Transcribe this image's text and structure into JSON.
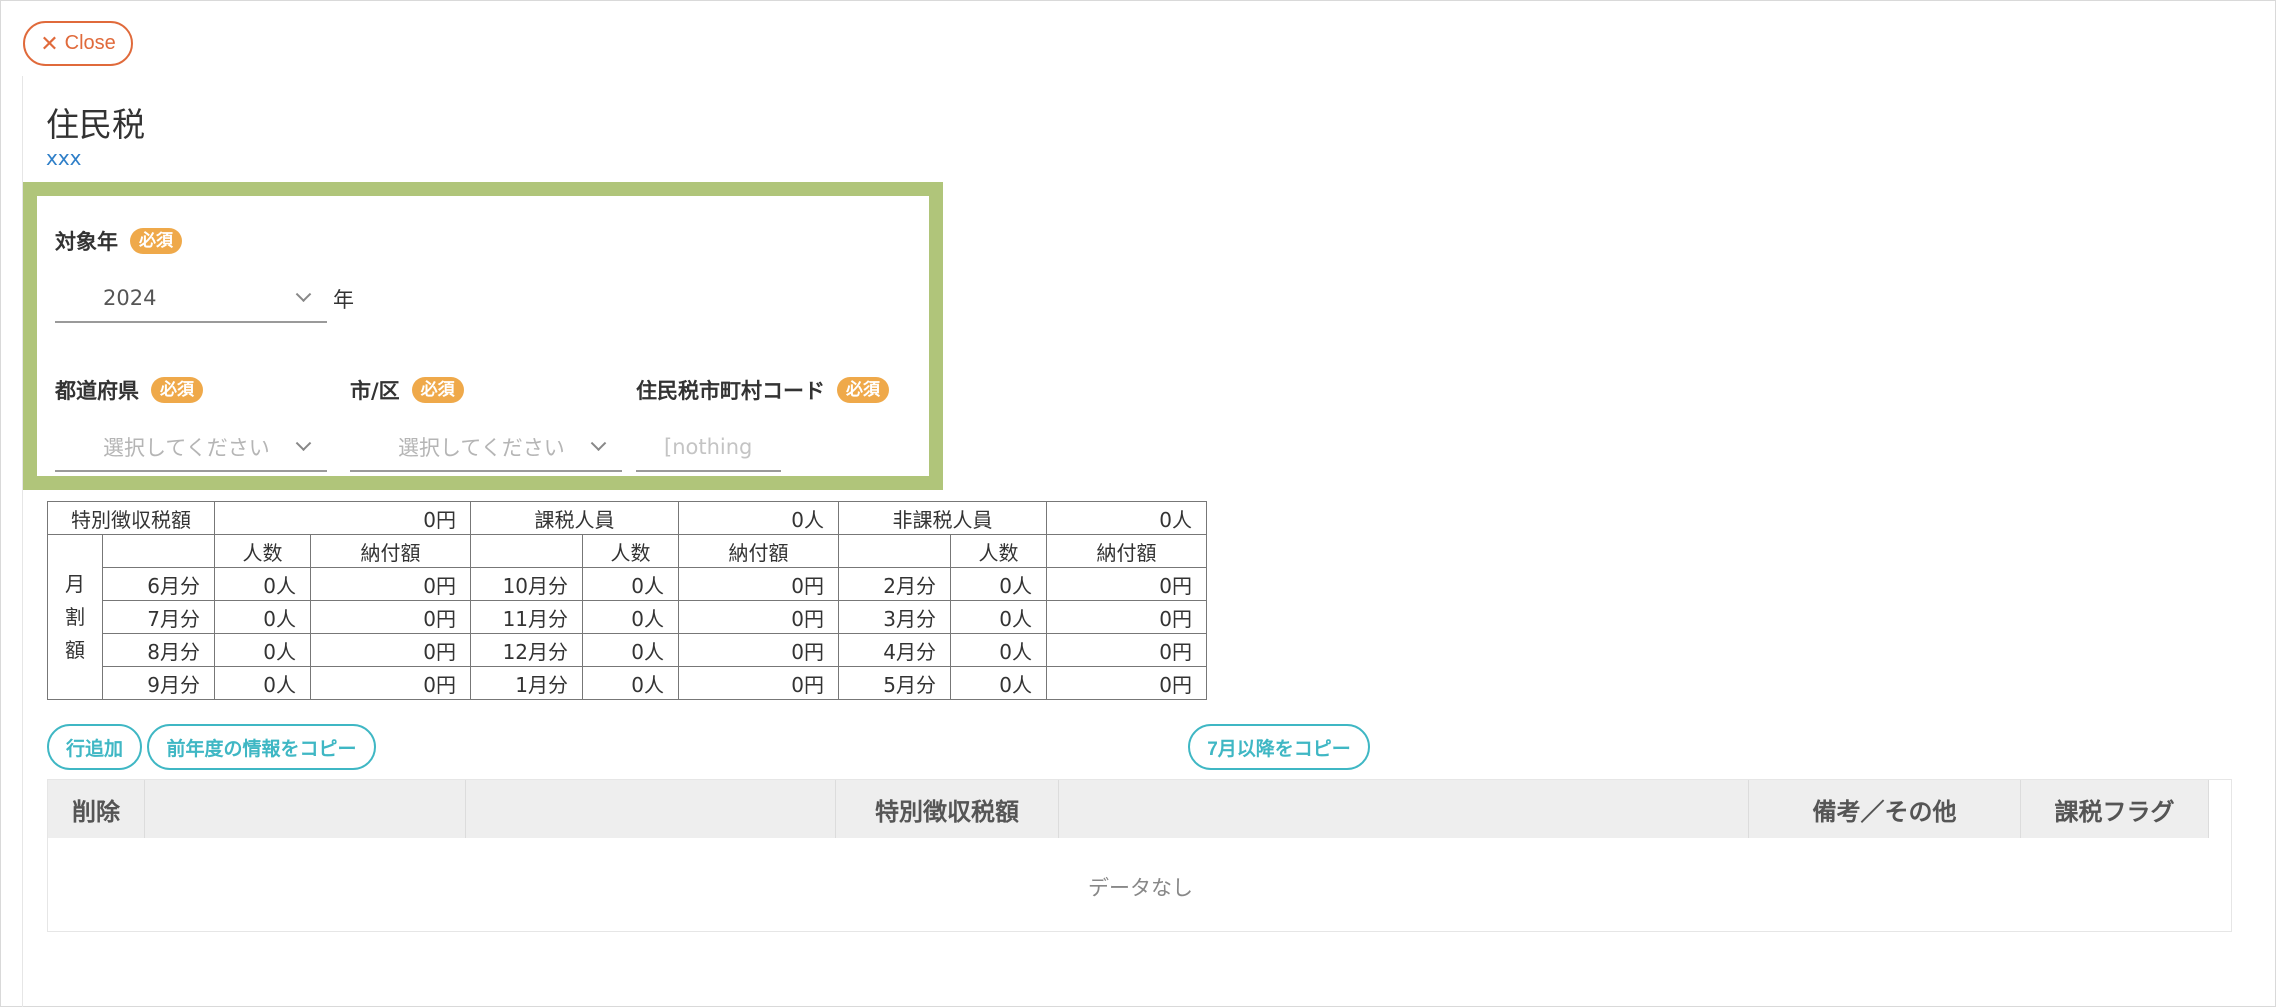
{
  "close": {
    "label": "Close"
  },
  "page": {
    "title": "住民税",
    "subtitle": "xxx"
  },
  "form": {
    "required_badge": "必須",
    "year": {
      "label": "対象年",
      "value": "2024",
      "unit": "年"
    },
    "prefecture": {
      "label": "都道府県",
      "placeholder": "選択してください"
    },
    "city": {
      "label": "市/区",
      "placeholder": "選択してください"
    },
    "code": {
      "label": "住民税市町村コード",
      "placeholder": "[nothing"
    }
  },
  "summary": {
    "special_tax_label": "特別徴収税額",
    "special_tax_value": "0円",
    "taxable_label": "課税人員",
    "taxable_value": "0人",
    "nontaxable_label": "非課税人員",
    "nontaxable_value": "0人",
    "col_people": "人数",
    "col_payment": "納付額",
    "monthly_label": [
      "月",
      "割",
      "額"
    ],
    "rows": [
      [
        {
          "m": "6月分",
          "p": "0人",
          "a": "0円"
        },
        {
          "m": "10月分",
          "p": "0人",
          "a": "0円"
        },
        {
          "m": "2月分",
          "p": "0人",
          "a": "0円"
        }
      ],
      [
        {
          "m": "7月分",
          "p": "0人",
          "a": "0円"
        },
        {
          "m": "11月分",
          "p": "0人",
          "a": "0円"
        },
        {
          "m": "3月分",
          "p": "0人",
          "a": "0円"
        }
      ],
      [
        {
          "m": "8月分",
          "p": "0人",
          "a": "0円"
        },
        {
          "m": "12月分",
          "p": "0人",
          "a": "0円"
        },
        {
          "m": "4月分",
          "p": "0人",
          "a": "0円"
        }
      ],
      [
        {
          "m": "9月分",
          "p": "0人",
          "a": "0円"
        },
        {
          "m": "1月分",
          "p": "0人",
          "a": "0円"
        },
        {
          "m": "5月分",
          "p": "0人",
          "a": "0円"
        }
      ]
    ]
  },
  "actions": {
    "add_row": "行追加",
    "copy_prev_year": "前年度の情報をコピー",
    "copy_after_july": "7月以降をコピー"
  },
  "grid": {
    "columns": {
      "delete": "削除",
      "special_tax": "特別徴収税額",
      "notes": "備考／その他",
      "tax_flag": "課税フラグ"
    },
    "empty": "データなし"
  },
  "colors": {
    "accent_close": "#e06a3b",
    "accent_action": "#3fb7c4",
    "highlight": "#b0c57a",
    "badge": "#efa94a",
    "link": "#2f7fc8"
  }
}
